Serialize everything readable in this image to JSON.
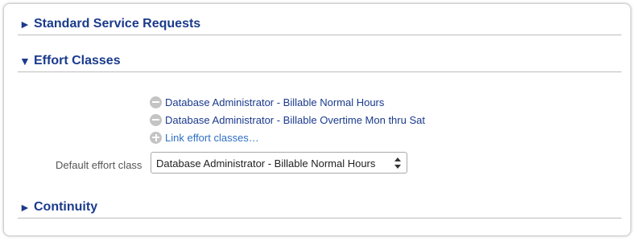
{
  "sections": {
    "standard": {
      "toggle": "►",
      "title": "Standard Service Requests"
    },
    "effort": {
      "toggle": "▼",
      "title": "Effort Classes"
    },
    "continuity": {
      "toggle": "►",
      "title": "Continuity"
    }
  },
  "effort_classes": {
    "items": [
      {
        "label": "Database Administrator - Billable Normal Hours",
        "icon": "minus-circle-icon"
      },
      {
        "label": "Database Administrator - Billable Overtime Mon thru Sat",
        "icon": "minus-circle-icon"
      }
    ],
    "link_label": "Link effort classes…",
    "link_icon": "plus-circle-icon",
    "default_label": "Default effort class",
    "default_value": "Database Administrator - Billable Normal Hours"
  },
  "colors": {
    "heading": "#1a3a8c",
    "link": "#2f6fc4",
    "icon_gray": "#c4c4c4"
  }
}
